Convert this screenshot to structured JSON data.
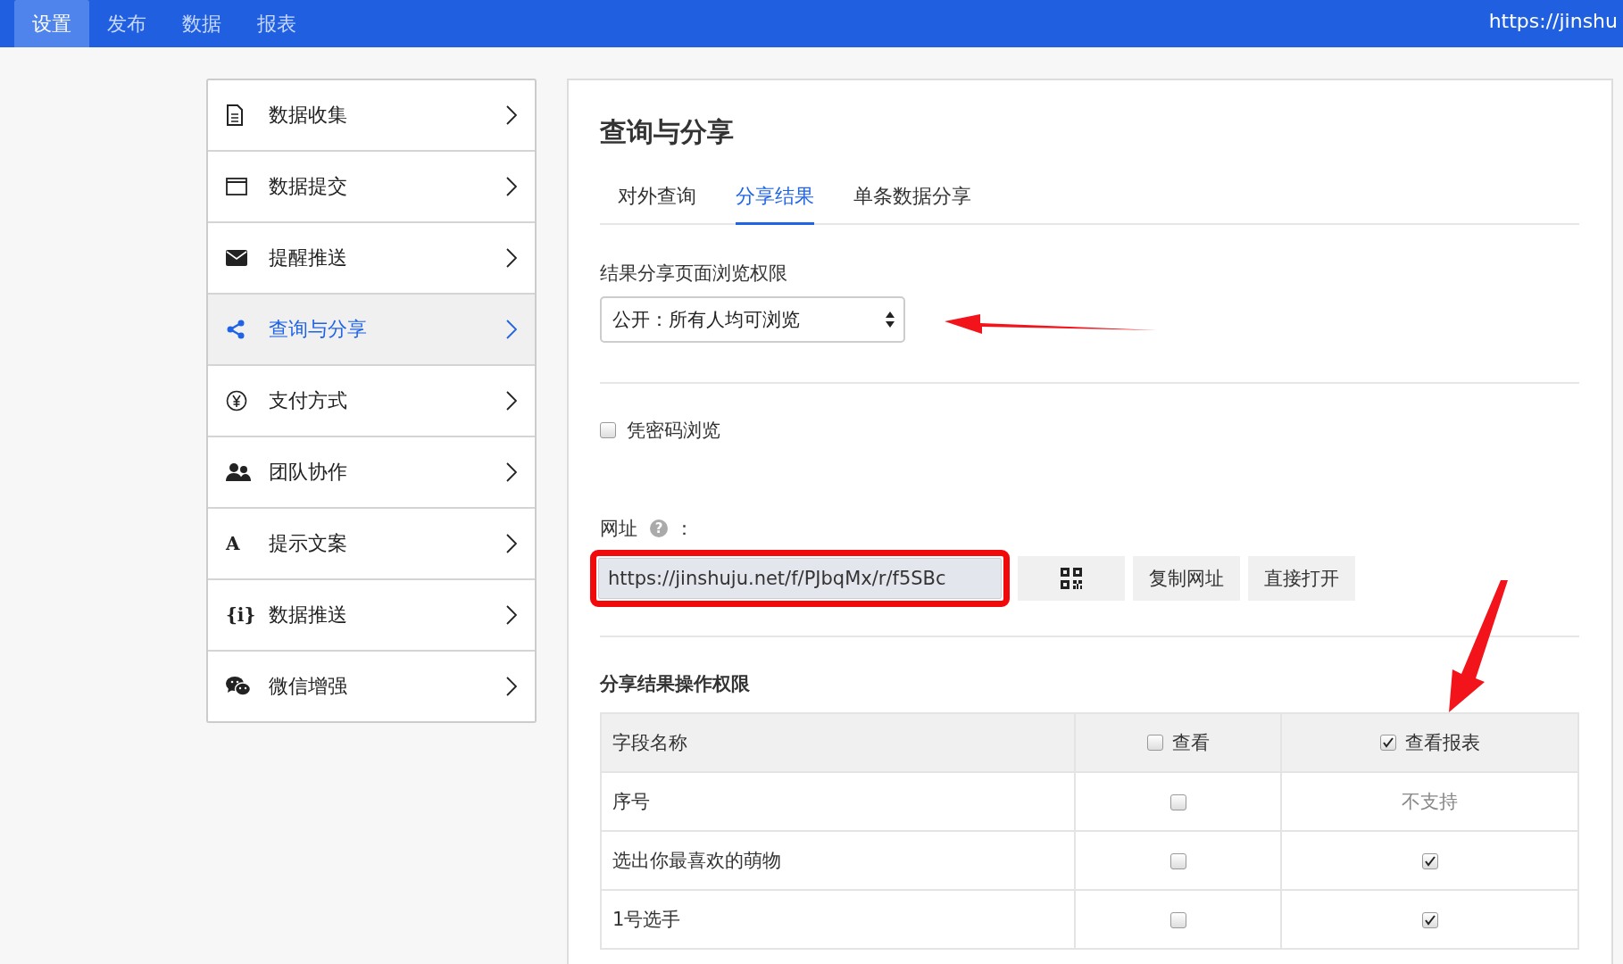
{
  "top_nav": {
    "tabs": [
      {
        "label": "设置",
        "selected": true
      },
      {
        "label": "发布",
        "selected": false
      },
      {
        "label": "数据",
        "selected": false
      },
      {
        "label": "报表",
        "selected": false
      }
    ],
    "url": "https://jinshu"
  },
  "sidebar": {
    "items": [
      {
        "kind": "document",
        "label": "数据收集",
        "selected": false
      },
      {
        "kind": "window",
        "label": "数据提交",
        "selected": false
      },
      {
        "kind": "envelope",
        "label": "提醒推送",
        "selected": false
      },
      {
        "kind": "share",
        "label": "查询与分享",
        "selected": true
      },
      {
        "kind": "yen",
        "label": "支付方式",
        "selected": false
      },
      {
        "kind": "people",
        "label": "团队协作",
        "selected": false
      },
      {
        "kind": "glyph",
        "glyph": "A",
        "label": "提示文案",
        "selected": false
      },
      {
        "kind": "glyph",
        "glyph": "{i}",
        "label": "数据推送",
        "selected": false
      },
      {
        "kind": "chat",
        "label": "微信增强",
        "selected": false
      }
    ]
  },
  "main": {
    "title": "查询与分享",
    "tabs": [
      {
        "label": "对外查询",
        "selected": false
      },
      {
        "label": "分享结果",
        "selected": true
      },
      {
        "label": "单条数据分享",
        "selected": false
      }
    ],
    "permission": {
      "label": "结果分享页面浏览权限",
      "value": "公开：所有人均可浏览"
    },
    "password": {
      "label": "凭密码浏览",
      "checked": false
    },
    "url": {
      "label": "网址",
      "help": "?",
      "colon": "：",
      "value": "https://jinshuju.net/f/PJbqMx/r/f5SBc",
      "buttons": [
        "复制网址",
        "直接打开"
      ]
    },
    "table": {
      "title": "分享结果操作权限",
      "columns": [
        {
          "kind": "text",
          "label": "字段名称"
        },
        {
          "kind": "checkbox",
          "label": "查看",
          "checked": false
        },
        {
          "kind": "checkbox",
          "label": "查看报表",
          "checked": true
        }
      ],
      "rows": [
        {
          "name": "序号",
          "view_checked": false,
          "report": {
            "kind": "text",
            "text": "不支持"
          }
        },
        {
          "name": "选出你最喜欢的萌物",
          "view_checked": false,
          "report": {
            "kind": "checkbox",
            "checked": true
          }
        },
        {
          "name": "1号选手",
          "view_checked": false,
          "report": {
            "kind": "checkbox",
            "checked": true
          }
        }
      ]
    }
  }
}
